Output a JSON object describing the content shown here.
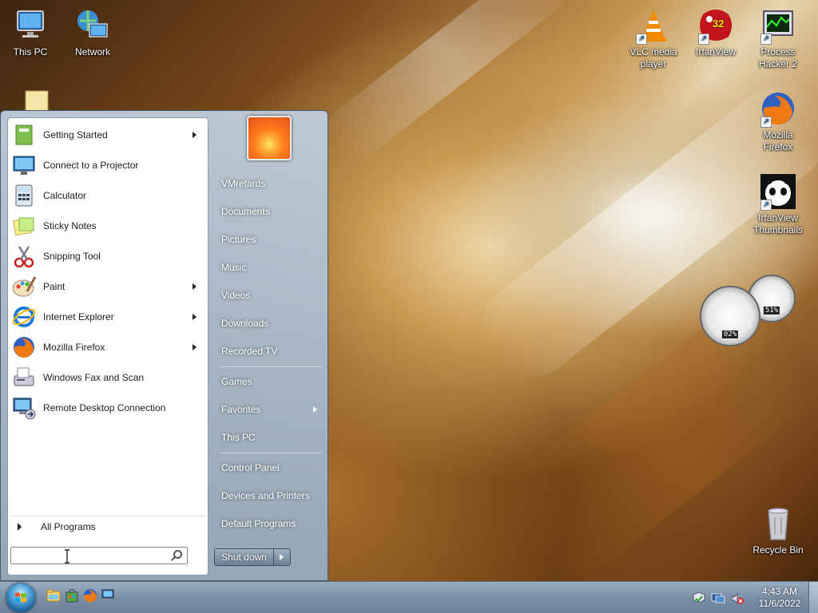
{
  "desktop": {
    "icons": [
      {
        "label": "This PC",
        "icon": "computer-icon"
      },
      {
        "label": "Network",
        "icon": "network-icon"
      },
      {
        "label": "VLC media player",
        "icon": "vlc-icon"
      },
      {
        "label": "IrfanView",
        "icon": "irfanview-icon",
        "badge": "32"
      },
      {
        "label": "Process Hacker 2",
        "icon": "process-hacker-icon"
      },
      {
        "label": "Mozilla Firefox",
        "icon": "firefox-icon"
      },
      {
        "label": "IrfanView Thumbnails",
        "icon": "irfanview-thumbnails-icon"
      },
      {
        "label": "Recycle Bin",
        "icon": "recycle-bin-icon"
      }
    ],
    "gadget": {
      "cpu_percent": "02%",
      "memory_percent": "51%"
    }
  },
  "start_menu": {
    "programs": [
      {
        "label": "Getting Started",
        "submenu": true,
        "icon": "getting-started-icon"
      },
      {
        "label": "Connect to a Projector",
        "submenu": false,
        "icon": "projector-icon"
      },
      {
        "label": "Calculator",
        "submenu": false,
        "icon": "calculator-icon"
      },
      {
        "label": "Sticky Notes",
        "submenu": false,
        "icon": "sticky-notes-icon"
      },
      {
        "label": "Snipping Tool",
        "submenu": false,
        "icon": "snipping-tool-icon"
      },
      {
        "label": "Paint",
        "submenu": true,
        "icon": "paint-icon"
      },
      {
        "label": "Internet Explorer",
        "submenu": true,
        "icon": "internet-explorer-icon"
      },
      {
        "label": "Mozilla Firefox",
        "submenu": true,
        "icon": "firefox-icon"
      },
      {
        "label": "Windows Fax and Scan",
        "submenu": false,
        "icon": "fax-scan-icon"
      },
      {
        "label": "Remote Desktop Connection",
        "submenu": false,
        "icon": "remote-desktop-icon"
      }
    ],
    "all_programs": "All Programs",
    "search_placeholder": "",
    "right_links": [
      {
        "label": "VMretards"
      },
      {
        "label": "Documents"
      },
      {
        "label": "Pictures"
      },
      {
        "label": "Music"
      },
      {
        "label": "Videos"
      },
      {
        "label": "Downloads"
      },
      {
        "label": "Recorded TV"
      },
      {
        "label": "Games"
      },
      {
        "label": "Favorites",
        "submenu": true
      },
      {
        "label": "This PC"
      },
      {
        "label": "Control Panel"
      },
      {
        "label": "Devices and Printers"
      },
      {
        "label": "Default Programs"
      }
    ],
    "shutdown_label": "Shut down"
  },
  "taskbar": {
    "pinned": [
      "explorer-icon",
      "store-bag-icon",
      "firefox-icon",
      "remote-desktop-icon"
    ],
    "tray_icons": [
      "action-center-icon",
      "network-tray-icon",
      "volume-muted-icon"
    ],
    "time": "4:43 AM",
    "date": "11/6/2022"
  }
}
